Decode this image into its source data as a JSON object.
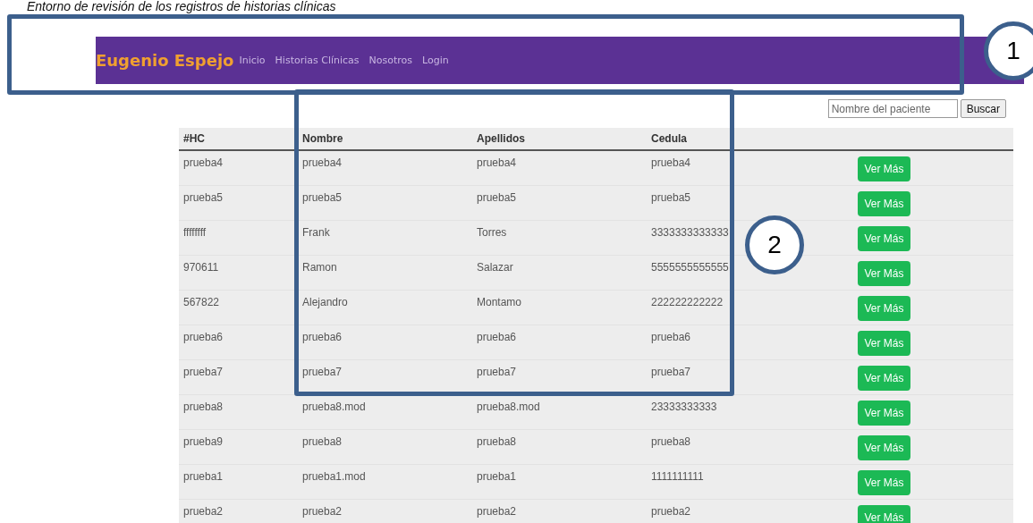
{
  "caption": "Entorno de revisión de los registros de historias clínicas",
  "navbar": {
    "brand": "Eugenio Espejo",
    "links": [
      "Inicio",
      "Historias Clínicas",
      "Nosotros",
      "Login"
    ]
  },
  "search": {
    "placeholder": "Nombre del paciente",
    "button": "Buscar"
  },
  "table": {
    "columns": [
      "#HC",
      "Nombre",
      "Apellidos",
      "Cedula"
    ],
    "rows": [
      {
        "cells": [
          "prueba4",
          "prueba4",
          "prueba4",
          "prueba4"
        ],
        "action": "Ver Más"
      },
      {
        "cells": [
          "prueba5",
          "prueba5",
          "prueba5",
          "prueba5"
        ],
        "action": "Ver Más"
      },
      {
        "cells": [
          "ffffffff",
          "Frank",
          "Torres",
          "3333333333333"
        ],
        "action": "Ver Más"
      },
      {
        "cells": [
          "970611",
          "Ramon",
          "Salazar",
          "5555555555555"
        ],
        "action": "Ver Más"
      },
      {
        "cells": [
          "567822",
          "Alejandro",
          "Montamo",
          "222222222222"
        ],
        "action": "Ver Más"
      },
      {
        "cells": [
          "prueba6",
          "prueba6",
          "prueba6",
          "prueba6"
        ],
        "action": "Ver Más"
      },
      {
        "cells": [
          "prueba7",
          "prueba7",
          "prueba7",
          "prueba7"
        ],
        "action": "Ver Más"
      },
      {
        "cells": [
          "prueba8",
          "prueba8.mod",
          "prueba8.mod",
          "23333333333"
        ],
        "action": "Ver Más"
      },
      {
        "cells": [
          "prueba9",
          "prueba8",
          "prueba8",
          "prueba8"
        ],
        "action": "Ver Más"
      },
      {
        "cells": [
          "prueba1",
          "prueba1.mod",
          "prueba1",
          "1111111111"
        ],
        "action": "Ver Más"
      },
      {
        "cells": [
          "prueba2",
          "prueba2",
          "prueba2",
          "prueba2"
        ],
        "action": "Ver Más"
      }
    ]
  },
  "callouts": [
    {
      "number": "1"
    },
    {
      "number": "2"
    }
  ]
}
